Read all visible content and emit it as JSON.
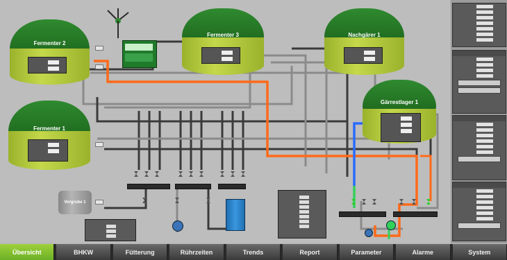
{
  "tanks": {
    "fermenter2": {
      "title": "Fermenter 2"
    },
    "fermenter3": {
      "title": "Fermenter 3"
    },
    "nachgarer1": {
      "title": "Nachgärer 1"
    },
    "gaerrestlager1": {
      "title": "Gärrestlager 1"
    },
    "fermenter1": {
      "title": "Fermenter 1"
    },
    "vorgrube1": {
      "title": "Vorgrube 1"
    }
  },
  "tabs": [
    {
      "label": "Übersicht"
    },
    {
      "label": "BHKW"
    },
    {
      "label": "Fütterung"
    },
    {
      "label": "Rührzeiten"
    },
    {
      "label": "Trends"
    },
    {
      "label": "Report"
    },
    {
      "label": "Parameter"
    },
    {
      "label": "Alarme"
    },
    {
      "label": "System"
    }
  ],
  "colors": {
    "active_tab": "#7fc02f",
    "dome": "#2a7d2a",
    "tank_body": "#b3c93c",
    "pipe_grey": "#8a8a8a",
    "pipe_dark": "#3a3a3a",
    "pipe_orange": "#ff6a1a",
    "pipe_blue": "#2a6bff",
    "pipe_green": "#32d05a"
  },
  "icons": {
    "stirrer": "stirrer-icon",
    "pump": "pump-icon",
    "valve": "valve-icon",
    "flare": "gas-flare-icon",
    "feeder": "feeder-icon"
  }
}
